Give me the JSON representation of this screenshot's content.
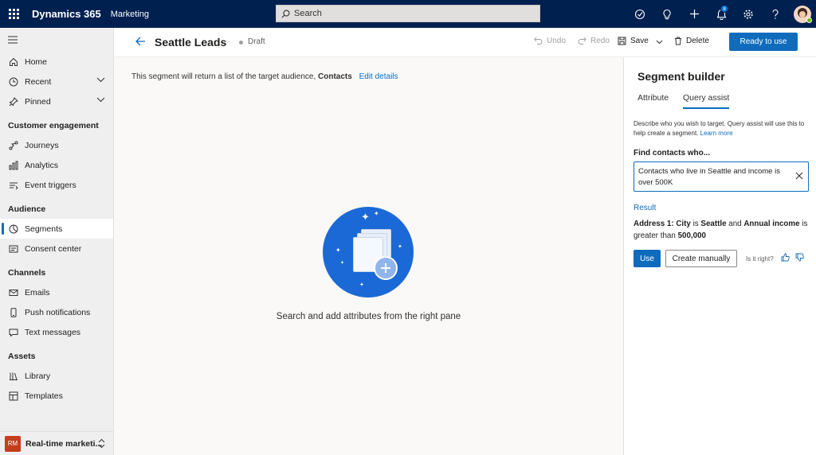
{
  "topbar": {
    "brand": "Dynamics 365",
    "app_name": "Marketing",
    "search_placeholder": "Search",
    "notification_count": "8"
  },
  "sidebar": {
    "items_top": [
      {
        "label": "Home",
        "icon": "home-icon"
      },
      {
        "label": "Recent",
        "icon": "clock-icon",
        "expandable": true
      },
      {
        "label": "Pinned",
        "icon": "pin-icon",
        "expandable": true
      }
    ],
    "sections": [
      {
        "title": "Customer engagement",
        "items": [
          {
            "label": "Journeys",
            "icon": "journey-icon"
          },
          {
            "label": "Analytics",
            "icon": "analytics-icon"
          },
          {
            "label": "Event triggers",
            "icon": "trigger-icon"
          }
        ]
      },
      {
        "title": "Audience",
        "items": [
          {
            "label": "Segments",
            "icon": "segments-icon",
            "active": true
          },
          {
            "label": "Consent center",
            "icon": "consent-icon"
          }
        ]
      },
      {
        "title": "Channels",
        "items": [
          {
            "label": "Emails",
            "icon": "mail-icon"
          },
          {
            "label": "Push notifications",
            "icon": "phone-icon"
          },
          {
            "label": "Text messages",
            "icon": "chat-icon"
          }
        ]
      },
      {
        "title": "Assets",
        "items": [
          {
            "label": "Library",
            "icon": "library-icon"
          },
          {
            "label": "Templates",
            "icon": "template-icon"
          }
        ]
      }
    ],
    "area": {
      "badge": "RM",
      "label": "Real-time marketi..."
    }
  },
  "command_bar": {
    "title": "Seattle Leads",
    "status": "Draft",
    "undo": "Undo",
    "redo": "Redo",
    "save": "Save",
    "delete": "Delete",
    "ready": "Ready to use"
  },
  "canvas": {
    "desc_prefix": "This segment will return a list of the target audience,",
    "desc_entity": "Contacts",
    "edit_link": "Edit details",
    "empty_message": "Search and add attributes from the right pane"
  },
  "pane": {
    "title": "Segment builder",
    "tabs": [
      "Attribute",
      "Query assist"
    ],
    "active_tab": "Query assist",
    "help_text": "Describe who you wish to target. Query assist will use this to help create a segment.",
    "learn_more": "Learn more",
    "find_label": "Find contacts who...",
    "query_value": "Contacts who live in Seattle and income is over 500K",
    "result_label": "Result",
    "result": {
      "part1": "Address 1: City",
      "part2": " is ",
      "part3": "Seattle",
      "part4": " and ",
      "part5": "Annual income",
      "part6": " is greater than ",
      "part7": "500,000"
    },
    "use_button": "Use",
    "manual_button": "Create manually",
    "feedback_label": "Is it right?"
  },
  "colors": {
    "topbar": "#002050",
    "accent": "#0f6cbd",
    "hero_circle": "#1b69d6",
    "area_badge": "#c43e1c"
  }
}
